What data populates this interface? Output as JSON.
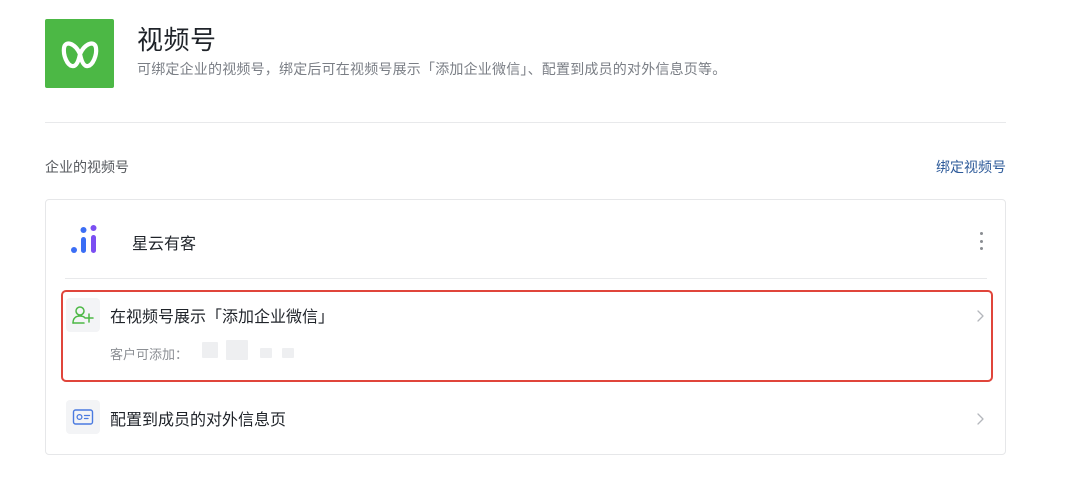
{
  "header": {
    "title": "视频号",
    "description": "可绑定企业的视频号，绑定后可在视频号展示「添加企业微信」、配置到成员的对外信息页等。",
    "icon": "channels-logo-icon",
    "icon_color": "#4cb845"
  },
  "section": {
    "title": "企业的视频号",
    "bind_link": "绑定视频号",
    "link_color": "#2e5b9a"
  },
  "account": {
    "name": "星云有客",
    "logo_icon": "account-logo-icon",
    "more_icon": "more-vertical-icon"
  },
  "rows": [
    {
      "title": "在视频号展示「添加企业微信」",
      "subtitle": "客户可添加：",
      "icon": "add-contact-icon",
      "highlighted": true
    },
    {
      "title": "配置到成员的对外信息页",
      "icon": "id-card-icon"
    }
  ],
  "highlight_color": "#e0453b"
}
